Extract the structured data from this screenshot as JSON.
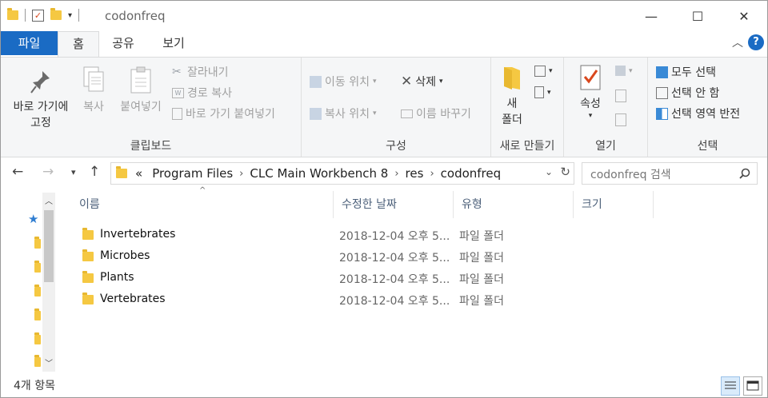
{
  "window": {
    "title": "codonfreq"
  },
  "tabs": [
    {
      "label": "파일"
    },
    {
      "label": "홈"
    },
    {
      "label": "공유"
    },
    {
      "label": "보기"
    }
  ],
  "clipboard": {
    "pin": "바로 가기에\n고정",
    "copy": "복사",
    "paste": "붙여넣기",
    "cut": "잘라내기",
    "copy_path": "경로 복사",
    "paste_shortcut": "바로 가기 붙여넣기",
    "label": "클립보드"
  },
  "organize": {
    "move_to": "이동 위치",
    "copy_to": "복사 위치",
    "delete": "삭제",
    "rename": "이름 바꾸기",
    "label": "구성"
  },
  "new": {
    "new_folder": "새\n폴더",
    "label": "새로 만들기"
  },
  "open": {
    "properties": "속성",
    "label": "열기"
  },
  "select": {
    "select_all": "모두 선택",
    "select_none": "선택 안 함",
    "invert": "선택 영역 반전",
    "label": "선택"
  },
  "address": {
    "crumbs": [
      "Program Files",
      "CLC Main Workbench 8",
      "res",
      "codonfreq"
    ],
    "overflow": "«"
  },
  "search": {
    "placeholder": "codonfreq 검색"
  },
  "columns": {
    "name": "이름",
    "date": "수정한 날짜",
    "type": "유형",
    "size": "크기"
  },
  "files": [
    {
      "name": "Invertebrates",
      "date": "2018-12-04 오후 5...",
      "type": "파일 폴더"
    },
    {
      "name": "Microbes",
      "date": "2018-12-04 오후 5...",
      "type": "파일 폴더"
    },
    {
      "name": "Plants",
      "date": "2018-12-04 오후 5...",
      "type": "파일 폴더"
    },
    {
      "name": "Vertebrates",
      "date": "2018-12-04 오후 5...",
      "type": "파일 폴더"
    }
  ],
  "status": {
    "count": "4개 항목"
  },
  "colors": {
    "accent": "#1a6bc4",
    "folder": "#f5c842"
  }
}
